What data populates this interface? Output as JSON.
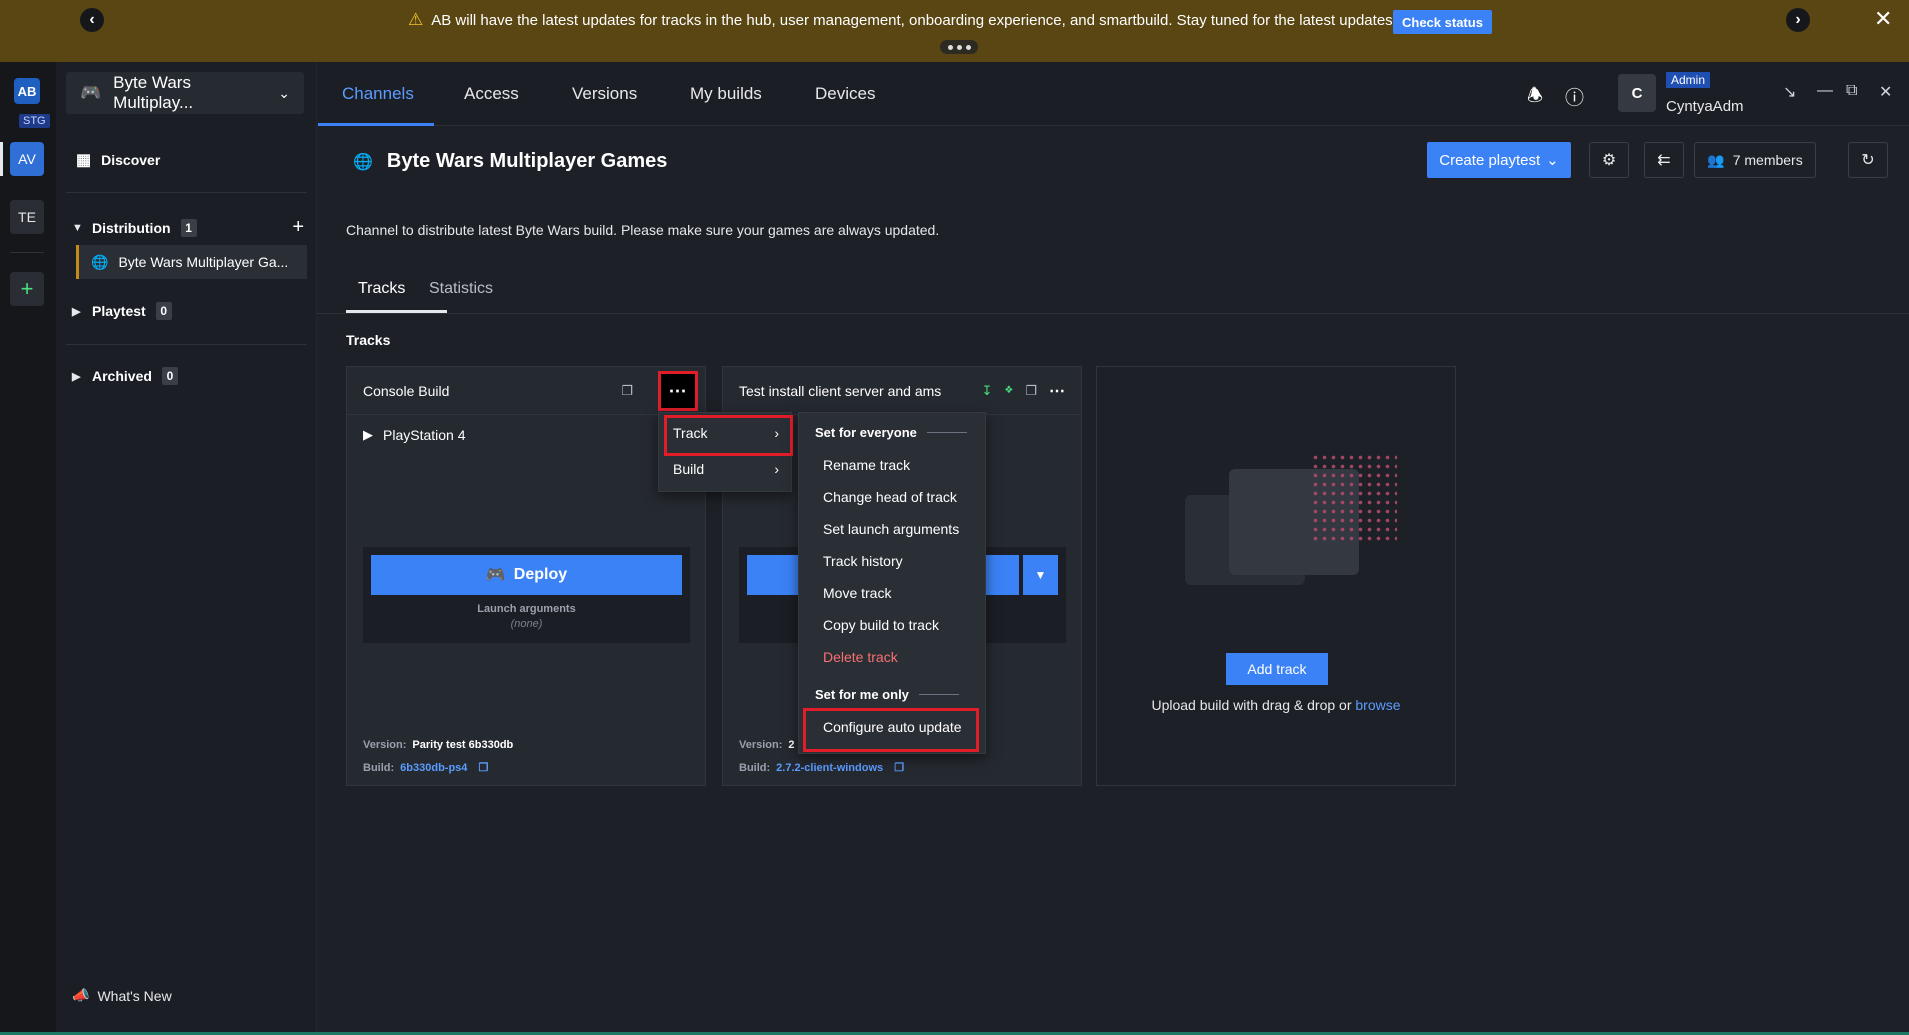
{
  "banner": {
    "message": "AB will have the latest updates for tracks in the hub, user management, onboarding experience, and smartbuild. Stay tuned for the latest updates!",
    "check_status_label": "Check status"
  },
  "rail": {
    "stage": "STG",
    "workspaces": [
      "AV",
      "TE"
    ]
  },
  "sidebar": {
    "project_name": "Byte Wars Multiplay...",
    "discover_label": "Discover",
    "sections": [
      {
        "label": "Distribution",
        "count": "1"
      },
      {
        "label": "Playtest",
        "count": "0"
      },
      {
        "label": "Archived",
        "count": "0"
      }
    ],
    "active_channel": "Byte Wars Multiplayer Ga...",
    "whats_new": "What's New"
  },
  "topnav": {
    "tabs": [
      "Channels",
      "Access",
      "Versions",
      "My builds",
      "Devices"
    ],
    "active_tab": "Channels",
    "avatar_initial": "C",
    "role": "Admin",
    "username": "CyntyaAdm"
  },
  "page": {
    "title": "Byte Wars Multiplayer Games",
    "create_playtest_label": "Create playtest",
    "members_label": "7 members",
    "description": "Channel to distribute latest Byte Wars build. Please make sure your games are always updated.",
    "subtabs": [
      "Tracks",
      "Statistics"
    ],
    "section_title": "Tracks"
  },
  "tracks": [
    {
      "name": "Console Build",
      "platform": "PlayStation 4",
      "deploy_label": "Deploy",
      "launch_label": "Launch arguments",
      "launch_value": "(none)",
      "version_label": "Version:",
      "version_value": "Parity test 6b330db",
      "build_label": "Build:",
      "build_value": "6b330db-ps4"
    },
    {
      "name": "Test install client server and ams",
      "version_label": "Version:",
      "version_value": "2",
      "build_label": "Build:",
      "build_value": "2.7.2-client-windows"
    }
  ],
  "add_track": {
    "button_label": "Add track",
    "upload_text": "Upload build with drag & drop or",
    "browse_label": "browse"
  },
  "menu_main": {
    "items": [
      "Track",
      "Build"
    ]
  },
  "menu_track": {
    "group_everyone": "Set for everyone",
    "items": [
      "Rename track",
      "Change head of track",
      "Set launch arguments",
      "Track history",
      "Move track",
      "Copy build to track"
    ],
    "delete_label": "Delete track",
    "group_me": "Set for me only",
    "configure_label": "Configure auto update"
  },
  "colors": {
    "accent": "#3b82f6",
    "banner": "#5a4612",
    "highlight": "#e11d2a",
    "danger": "#f87171"
  }
}
